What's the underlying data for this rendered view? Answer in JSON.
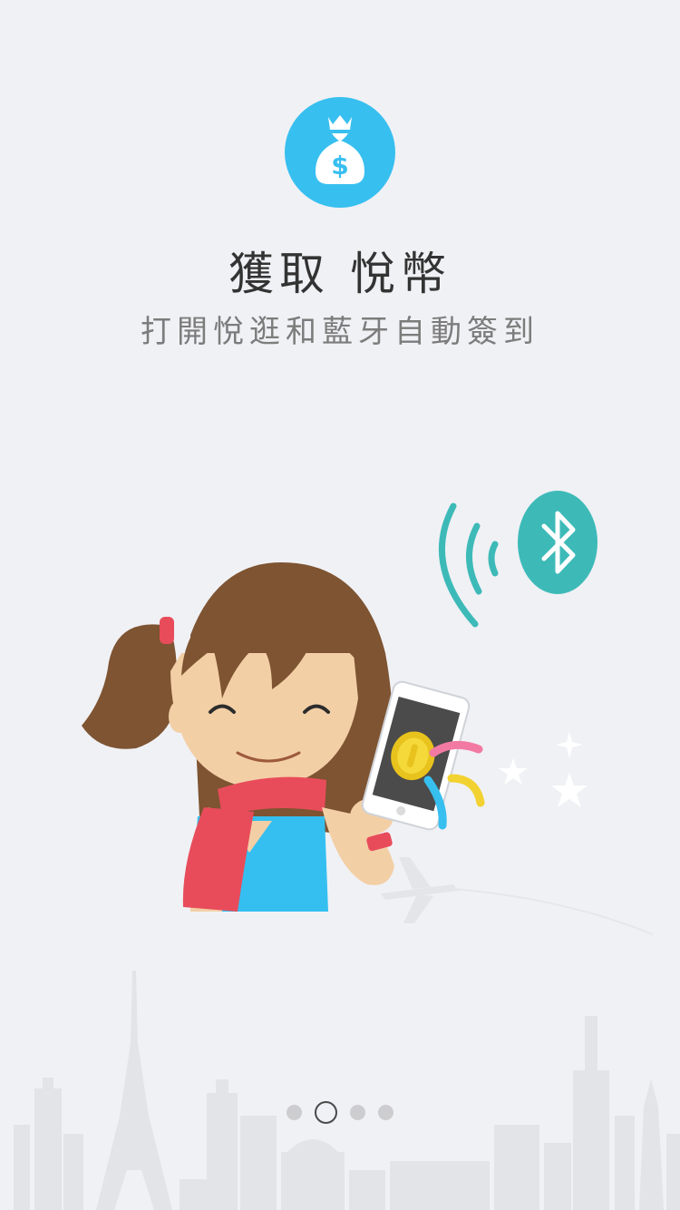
{
  "onboarding": {
    "title": "獲取 悅幣",
    "subtitle": "打開悅逛和藍牙自動簽到",
    "top_icon": "money-bag-icon",
    "illustration_icon": "bluetooth-icon",
    "accent_color": "#37bfef",
    "bluetooth_color": "#3dbab8",
    "background_color": "#f0f1f5"
  },
  "pager": {
    "total_pages": 4,
    "current_page": 2
  }
}
